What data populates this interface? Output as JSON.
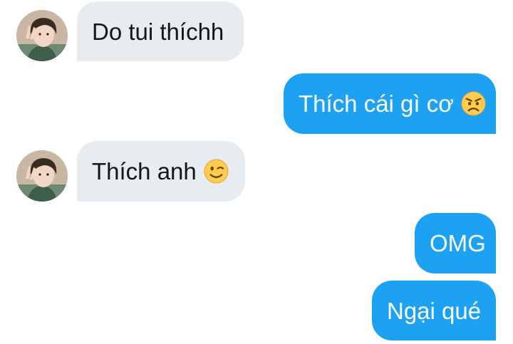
{
  "conversation": {
    "messages": [
      {
        "direction": "incoming",
        "text": "Do tui thíchh",
        "emoji": null
      },
      {
        "direction": "outgoing",
        "text": "Thích cái gì cơ",
        "emoji": "angry-face-icon"
      },
      {
        "direction": "incoming",
        "text": "Thích anh",
        "emoji": "winking-face-icon"
      },
      {
        "direction": "outgoing",
        "text": "OMG",
        "emoji": null
      },
      {
        "direction": "outgoing",
        "text": "Ngại qué",
        "emoji": null
      }
    ]
  },
  "colors": {
    "incoming_bubble": "#e6ecf0",
    "outgoing_bubble": "#1da1f2",
    "incoming_text": "#14171a",
    "outgoing_text": "#ffffff"
  }
}
